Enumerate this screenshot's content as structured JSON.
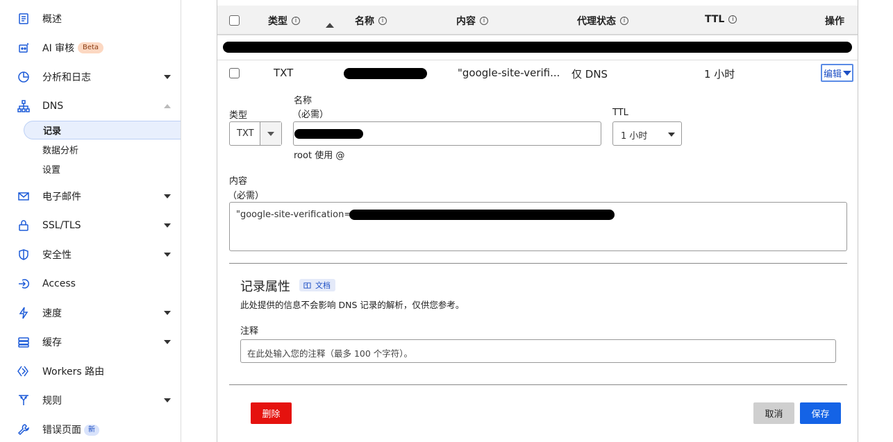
{
  "sidebar": {
    "items": [
      {
        "label": "概述",
        "icon": "document-icon"
      },
      {
        "label": "AI 审核",
        "icon": "robot-icon",
        "badge": "Beta"
      },
      {
        "label": "分析和日志",
        "icon": "chart-icon"
      },
      {
        "label": "DNS",
        "icon": "network-icon"
      },
      {
        "label": "电子邮件",
        "icon": "email-icon"
      },
      {
        "label": "SSL/TLS",
        "icon": "lock-icon"
      },
      {
        "label": "安全性",
        "icon": "shield-icon"
      },
      {
        "label": "Access",
        "icon": "access-icon"
      },
      {
        "label": "速度",
        "icon": "bolt-icon"
      },
      {
        "label": "缓存",
        "icon": "storage-icon"
      },
      {
        "label": "Workers 路由",
        "icon": "workers-icon"
      },
      {
        "label": "规则",
        "icon": "rules-icon"
      },
      {
        "label": "错误页面",
        "icon": "wrench-icon",
        "badge": "新"
      }
    ],
    "dns_sub": [
      "记录",
      "数据分析",
      "设置"
    ]
  },
  "table": {
    "headers": {
      "type": "类型",
      "name": "名称",
      "content": "内容",
      "proxy": "代理状态",
      "ttl": "TTL",
      "actions": "操作"
    },
    "info_icon": "info-icon",
    "row": {
      "type": "TXT",
      "content": "\"google-site-verifi...",
      "proxy": "仅 DNS",
      "ttl": "1 小时",
      "edit": "编辑"
    }
  },
  "form": {
    "type_label": "类型",
    "type_value": "TXT",
    "name_label": "名称",
    "name_required": "（必需）",
    "name_hint": "root 使用 @",
    "ttl_label": "TTL",
    "ttl_value": "1 小时",
    "content_label": "内容",
    "content_required": "（必需）",
    "content_value": "\"google-site-verification="
  },
  "attributes": {
    "title": "记录属性",
    "doc_link": "文档",
    "description": "此处提供的信息不会影响 DNS 记录的解析，仅供您参考。",
    "note_label": "注释",
    "note_placeholder": "在此处输入您的注释（最多 100 个字符）。"
  },
  "buttons": {
    "delete": "删除",
    "cancel": "取消",
    "save": "保存"
  },
  "colors": {
    "accent": "#1463e6",
    "danger": "#e5120e"
  }
}
